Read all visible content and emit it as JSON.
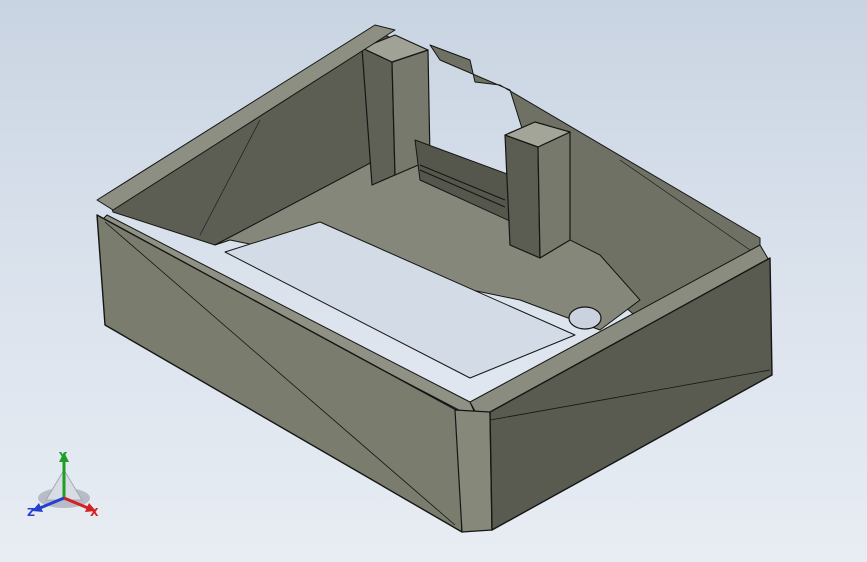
{
  "viewport": {
    "colors": {
      "background_top": "#c9d4e2",
      "background_bottom": "#e8edf3",
      "model_face": "#75776a",
      "model_edge": "#111111"
    }
  },
  "triad": {
    "labels": {
      "x": "X",
      "y": "Y",
      "z": "Z"
    },
    "colors": {
      "x": "#d42020",
      "y": "#1f9d2a",
      "z": "#2540d0"
    }
  }
}
